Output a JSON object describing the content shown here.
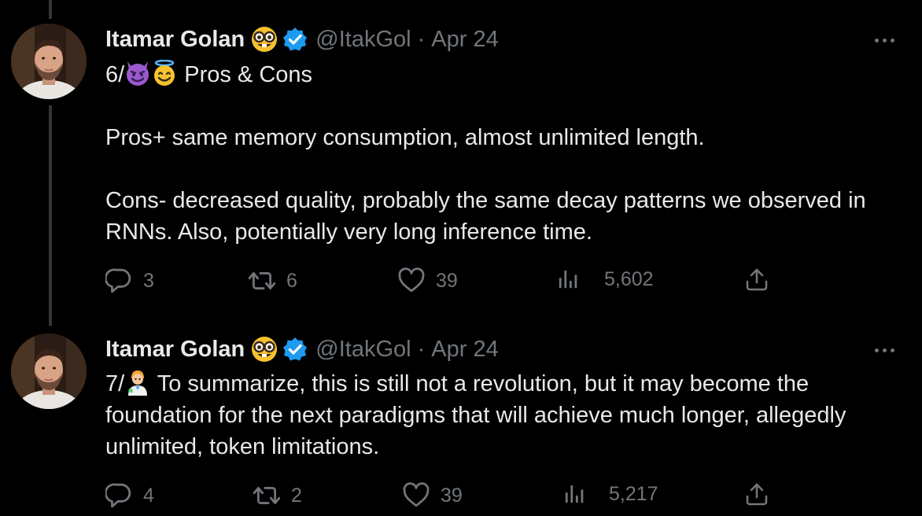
{
  "tweets": [
    {
      "author_name": "Itamar Golan",
      "handle": "@ItakGol",
      "separator": "·",
      "date": "Apr 24",
      "name_emoji": "nerd-face-emoji",
      "intro": "6/",
      "intro_emojis": [
        "smiling-face-with-horns-emoji",
        "smiling-face-with-halo-emoji"
      ],
      "intro_text": " Pros & Cons",
      "paragraphs": [
        "Pros+ same memory consumption, almost unlimited length.",
        "Cons- decreased quality, probably the same decay patterns we observed in RNNs. Also, potentially very long inference time."
      ],
      "replies": "3",
      "retweets": "6",
      "likes": "39",
      "views": "5,602"
    },
    {
      "author_name": "Itamar Golan",
      "handle": "@ItakGol",
      "separator": "·",
      "date": "Apr 24",
      "name_emoji": "nerd-face-emoji",
      "intro": "7/",
      "intro_emojis": [
        "scientist-emoji"
      ],
      "intro_text": " To summarize, this is still not a revolution, but it may become the foundation for the next paradigms that will achieve much longer, allegedly unlimited, token limitations.",
      "replies": "4",
      "retweets": "2",
      "likes": "39",
      "views": "5,217"
    }
  ],
  "colors": {
    "background": "#000000",
    "text": "#e7e9ea",
    "muted": "#71767b",
    "verified": "#1d9bf0",
    "thread_line": "#333639"
  },
  "icons": [
    "reply-icon",
    "retweet-icon",
    "like-icon",
    "views-icon",
    "share-icon",
    "more-icon",
    "verified-badge-icon"
  ]
}
